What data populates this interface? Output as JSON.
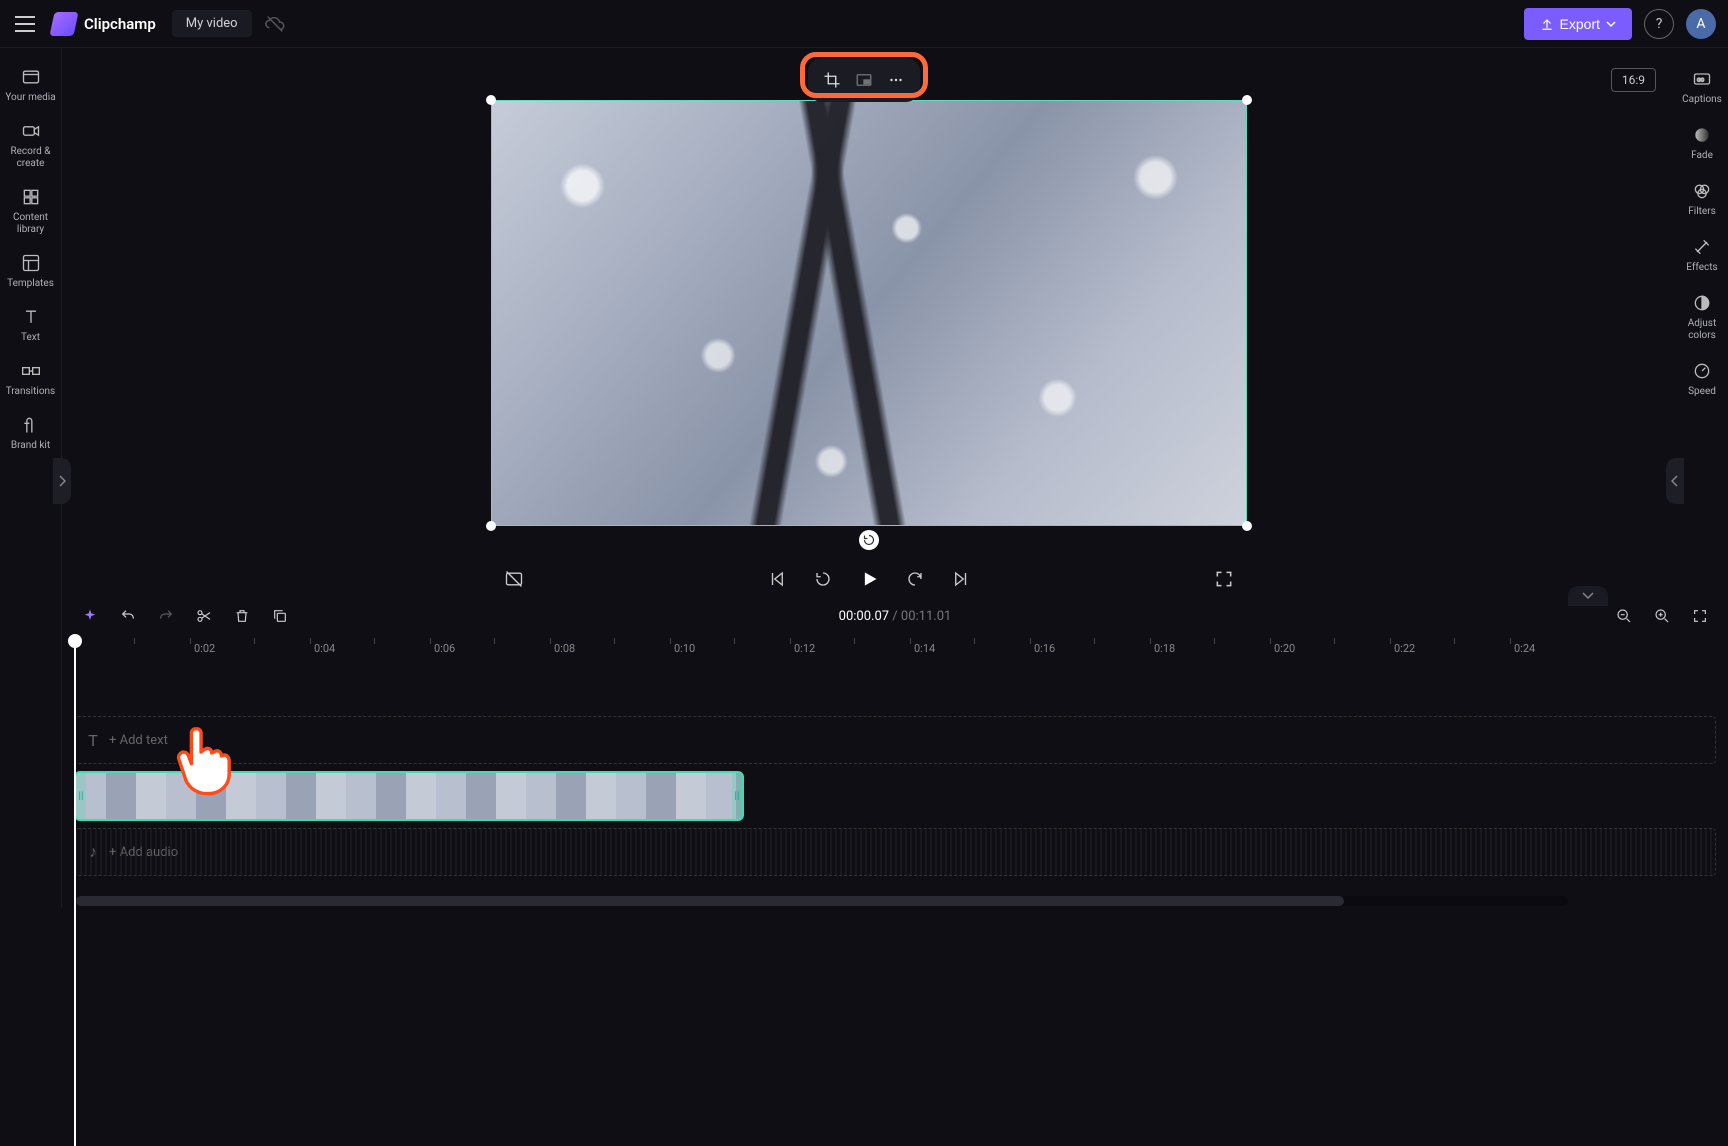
{
  "header": {
    "brand": "Clipchamp",
    "project_name": "My video",
    "export_label": "Export",
    "avatar_letter": "A"
  },
  "left_sidebar": {
    "items": [
      {
        "id": "your-media",
        "label": "Your media"
      },
      {
        "id": "record-create",
        "label": "Record & create"
      },
      {
        "id": "content-library",
        "label": "Content library"
      },
      {
        "id": "templates",
        "label": "Templates"
      },
      {
        "id": "text",
        "label": "Text"
      },
      {
        "id": "transitions",
        "label": "Transitions"
      },
      {
        "id": "brand-kit",
        "label": "Brand kit"
      }
    ]
  },
  "right_sidebar": {
    "items": [
      {
        "id": "captions",
        "label": "Captions"
      },
      {
        "id": "fade",
        "label": "Fade"
      },
      {
        "id": "filters",
        "label": "Filters"
      },
      {
        "id": "effects",
        "label": "Effects"
      },
      {
        "id": "adjust-colors",
        "label": "Adjust colors"
      },
      {
        "id": "speed",
        "label": "Speed"
      }
    ]
  },
  "preview": {
    "aspect_label": "16:9"
  },
  "player": {
    "current_time": "00:00.07",
    "separator": " / ",
    "duration": "00:11.01"
  },
  "ruler": {
    "labels": [
      "0:02",
      "0:04",
      "0:06",
      "0:08",
      "0:10",
      "0:12",
      "0:14",
      "0:16",
      "0:18",
      "0:20",
      "0:22",
      "0:24"
    ]
  },
  "tracks": {
    "text_placeholder": "+ Add text",
    "audio_placeholder": "+ Add audio"
  },
  "colors": {
    "accent": "#7b5cff",
    "highlight": "#ff6a3d",
    "selection": "#3fdcb0"
  }
}
